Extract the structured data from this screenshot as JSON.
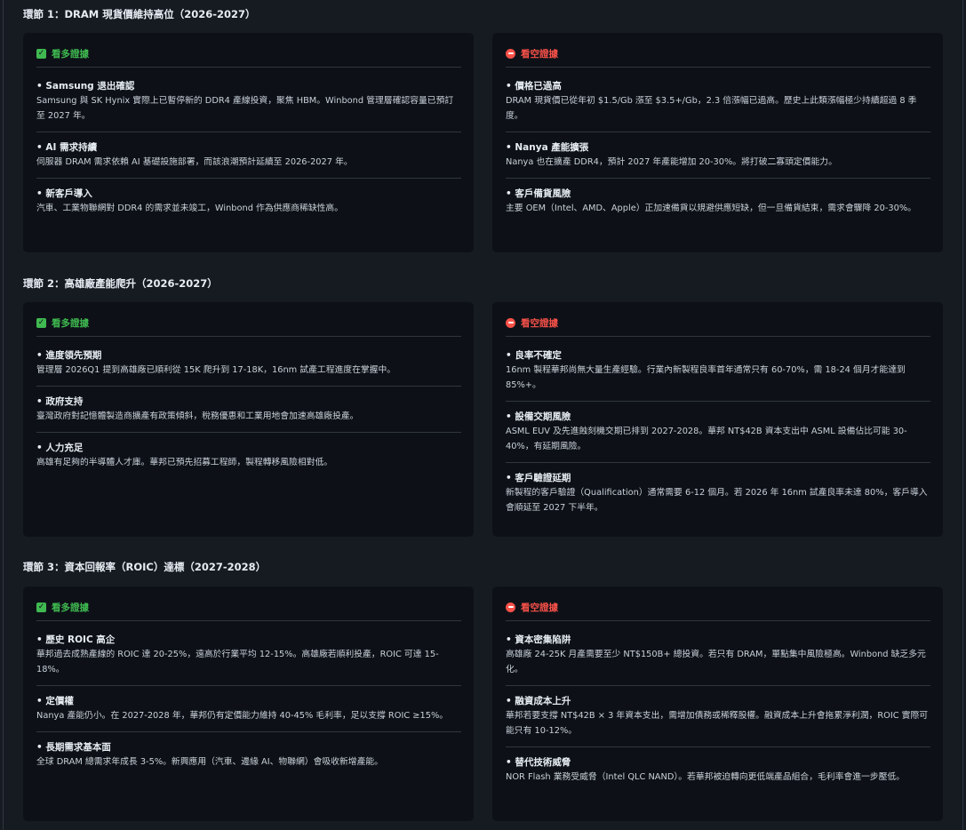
{
  "bull_label": "看多證據",
  "bear_label": "看空證據",
  "sections": [
    {
      "title": "環節 1：DRAM 現貨價維持高位（2026-2027）",
      "bull": [
        {
          "title": "Samsung 退出確認",
          "body": "Samsung 與 SK Hynix 實際上已暫停新的 DDR4 產線投資，聚焦 HBM。Winbond 管理層確認容量已預訂至 2027 年。"
        },
        {
          "title": "AI 需求持續",
          "body": "伺服器 DRAM 需求依賴 AI 基礎設施部署，而該浪潮預計延續至 2026-2027 年。"
        },
        {
          "title": "新客戶導入",
          "body": "汽車、工業物聯網對 DDR4 的需求並未竣工，Winbond 作為供應商稀缺性高。"
        }
      ],
      "bear": [
        {
          "title": "價格已過高",
          "body": "DRAM 現貨價已從年初 $1.5/Gb 漲至 $3.5+/Gb，2.3 倍漲幅已過高。歷史上此類漲幅極少持續超過 8 季度。"
        },
        {
          "title": "Nanya 產能擴張",
          "body": "Nanya 也在擴產 DDR4，預計 2027 年產能增加 20-30%。將打破二寡頭定價能力。"
        },
        {
          "title": "客戶備貨風險",
          "body": "主要 OEM（Intel、AMD、Apple）正加速備貨以規避供應短缺，但一旦備貨結束，需求會驟降 20-30%。"
        }
      ]
    },
    {
      "title": "環節 2：高雄廠產能爬升（2026-2027）",
      "bull": [
        {
          "title": "進度領先預期",
          "body": "管理層 2026Q1 提到高雄廠已順利從 15K 爬升到 17-18K，16nm 試產工程進度在掌握中。"
        },
        {
          "title": "政府支持",
          "body": "臺灣政府對記憶體製造商擴產有政策傾斜，稅務優惠和工業用地會加速高雄廠投產。"
        },
        {
          "title": "人力充足",
          "body": "高雄有足夠的半導體人才庫。華邦已預先招募工程師，製程轉移風險相對低。"
        }
      ],
      "bear": [
        {
          "title": "良率不確定",
          "body": "16nm 製程華邦尚無大量生產經驗。行業內新製程良率首年通常只有 60-70%，需 18-24 個月才能達到 85%+。"
        },
        {
          "title": "設備交期風險",
          "body": "ASML EUV 及先進蝕刻機交期已排到 2027-2028。華邦 NT$42B 資本支出中 ASML 設備佔比可能 30-40%，有延期風險。"
        },
        {
          "title": "客戶驗證延期",
          "body": "新製程的客戶驗證（Qualification）通常需要 6-12 個月。若 2026 年 16nm 試產良率未達 80%，客戶導入會順延至 2027 下半年。"
        }
      ]
    },
    {
      "title": "環節 3：資本回報率（ROIC）達標（2027-2028）",
      "bull": [
        {
          "title": "歷史 ROIC 高企",
          "body": "華邦過去成熟產線的 ROIC 達 20-25%，遠高於行業平均 12-15%。高雄廠若順利投產，ROIC 可達 15-18%。"
        },
        {
          "title": "定價權",
          "body": "Nanya 產能仍小。在 2027-2028 年，華邦仍有定價能力維持 40-45% 毛利率，足以支撐 ROIC ≥15%。"
        },
        {
          "title": "長期需求基本面",
          "body": "全球 DRAM 總需求年成長 3-5%。新興應用（汽車、邊緣 AI、物聯網）會吸收新增產能。"
        }
      ],
      "bear": [
        {
          "title": "資本密集陷阱",
          "body": "高雄廠 24-25K 月產需要至少 NT$150B+ 總投資。若只有 DRAM，單點集中風險極高。Winbond 缺乏多元化。"
        },
        {
          "title": "融資成本上升",
          "body": "華邦若要支撐 NT$42B × 3 年資本支出，需增加債務或稀釋股權。融資成本上升會拖累淨利潤，ROIC 實際可能只有 10-12%。"
        },
        {
          "title": "替代技術威脅",
          "body": "NOR Flash 業務受威脅（Intel QLC NAND）。若華邦被迫轉向更低端產品組合，毛利率會進一步壓低。"
        }
      ]
    }
  ]
}
